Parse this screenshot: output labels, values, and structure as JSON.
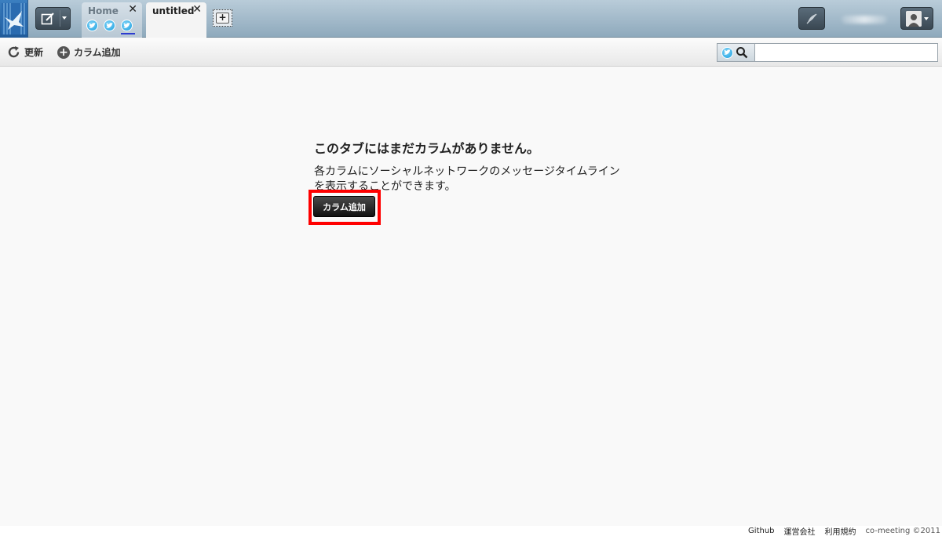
{
  "tabs": [
    {
      "label": "Home",
      "icons": [
        "twitter-icon",
        "twitter-icon",
        "twitter-icon"
      ]
    },
    {
      "label": "untitled"
    }
  ],
  "tab_close_glyph": "✕",
  "add_tab_glyph": "+",
  "toolbar": {
    "refresh_label": "更新",
    "add_column_label": "カラム追加"
  },
  "search": {
    "value": "",
    "placeholder": ""
  },
  "empty_state": {
    "title": "このタブにはまだカラムがありません。",
    "description": "各カラムにソーシャルネットワークのメッセージタイムラインを表示することができます。",
    "button_label": "カラム追加"
  },
  "footer": {
    "github": "Github",
    "company": "運営会社",
    "terms": "利用規約",
    "copyright": "co-meeting ©2011"
  },
  "colors": {
    "accent": "#1ea0e0",
    "header": "#8ea9bc",
    "highlight": "#ff0000"
  }
}
